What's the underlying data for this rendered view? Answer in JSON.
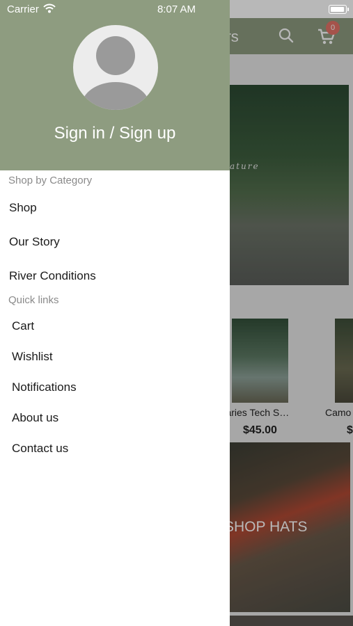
{
  "status_bar": {
    "carrier": "Carrier",
    "time": "8:07 AM"
  },
  "background_app": {
    "title_partial": "oors",
    "cart_count": "0",
    "hero_text_partial": "ature",
    "products": [
      {
        "name": "butaries Tech S…",
        "price": "$45.00"
      },
      {
        "name": "Camo",
        "price": "$"
      }
    ],
    "banner_label": "SHOP HATS"
  },
  "drawer": {
    "header_color": "#8e9c80",
    "sign_in_label": "Sign in / Sign up",
    "sections": {
      "category_title": "Shop by Category",
      "category_items": [
        "Shop",
        "Our Story",
        "River Conditions"
      ],
      "quick_title": "Quick links",
      "quick_items": [
        "Cart",
        "Wishlist",
        "Notifications",
        "About us",
        "Contact us"
      ]
    }
  },
  "icons": {
    "wifi": "wifi-icon",
    "battery": "battery-icon",
    "avatar": "user-avatar-icon",
    "search": "search-icon",
    "cart": "cart-icon"
  }
}
